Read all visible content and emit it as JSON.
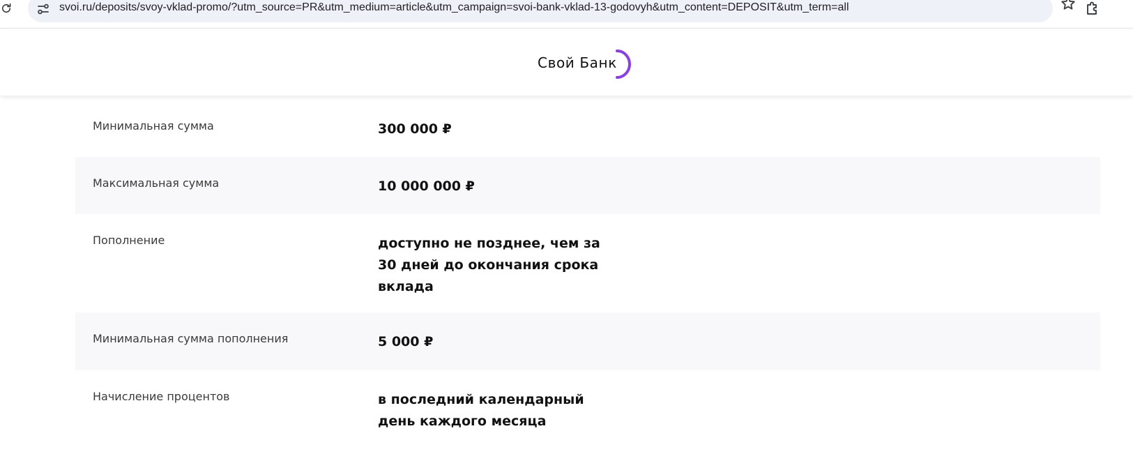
{
  "browser": {
    "url": "svoi.ru/deposits/svoy-vklad-promo/?utm_source=PR&utm_medium=article&utm_campaign=svoi-bank-vklad-13-godovyh&utm_content=DEPOSIT&utm_term=all",
    "icons": [
      "reload-icon",
      "site-info-icon",
      "star-icon",
      "extensions-icon"
    ]
  },
  "header": {
    "logo_text": "Свой Банк",
    "brand_color": "#8b3fe0"
  },
  "conditions": [
    {
      "label": "Минимальная сумма",
      "value": "300 000 ₽"
    },
    {
      "label": "Максимальная сумма",
      "value": "10 000 000 ₽"
    },
    {
      "label": "Пополнение",
      "value": "доступно не позднее, чем за 30 дней до окончания срока вклада"
    },
    {
      "label": "Минимальная сумма пополнения",
      "value": "5 000 ₽"
    },
    {
      "label": "Начисление процентов",
      "value": "в последний календарный день каждого месяца"
    }
  ]
}
